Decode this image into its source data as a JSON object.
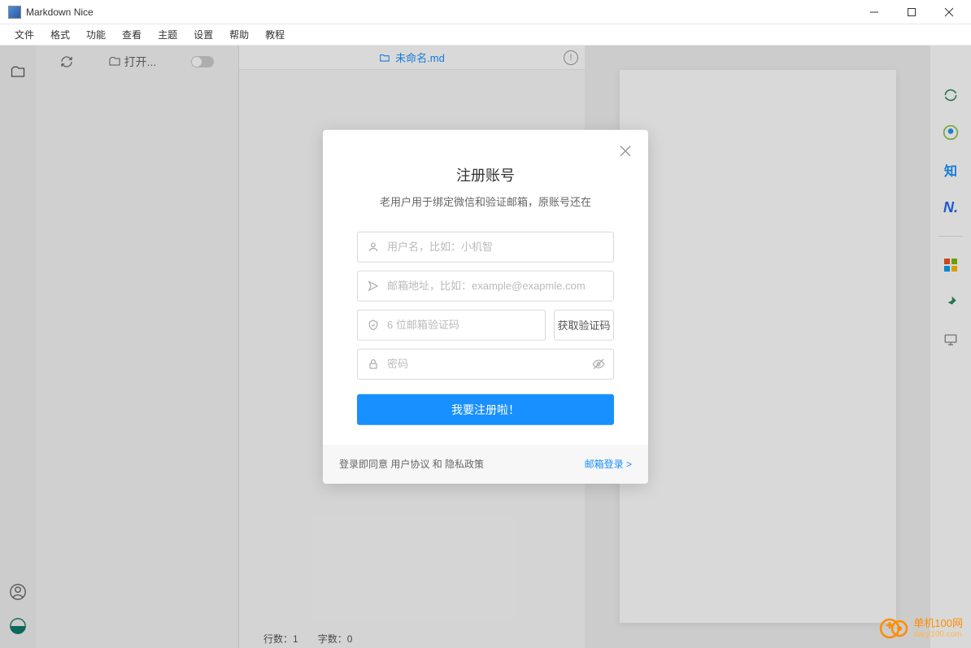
{
  "titlebar": {
    "title": "Markdown Nice"
  },
  "menubar": {
    "items": [
      "文件",
      "格式",
      "功能",
      "查看",
      "主题",
      "设置",
      "帮助",
      "教程"
    ]
  },
  "sidebar": {
    "open_label": "打开..."
  },
  "tabbar": {
    "filename": "未命名.md"
  },
  "statusbar": {
    "lines_label": "行数：",
    "lines_value": "1",
    "words_label": "字数：",
    "words_value": "0"
  },
  "modal": {
    "title": "注册账号",
    "subtitle": "老用户用于绑定微信和验证邮箱，原账号还在",
    "username_placeholder": "用户名，比如：小机智",
    "email_placeholder": "邮箱地址，比如：example@exapmle.com",
    "code_placeholder": "6 位邮箱验证码",
    "get_code_label": "获取验证码",
    "password_placeholder": "密码",
    "submit_label": "我要注册啦！",
    "agree_prefix": "登录即同意 ",
    "agree_terms": "用户协议",
    "agree_and": " 和 ",
    "agree_privacy": "隐私政策",
    "login_link": "邮箱登录 >"
  },
  "watermark": {
    "text": "单机100网",
    "url": "danji100.com"
  }
}
